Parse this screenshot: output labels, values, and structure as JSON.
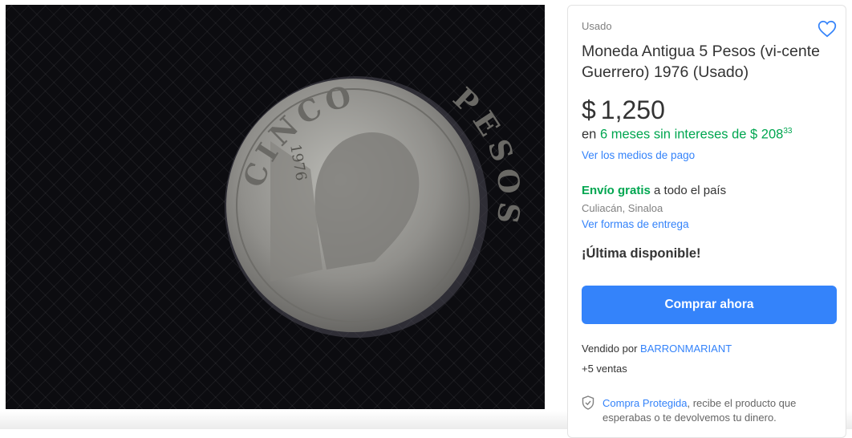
{
  "image": {
    "alt_icon": "coin-photo",
    "coin_text": {
      "top": "CINCO",
      "right": "PESOS",
      "year": "1976"
    }
  },
  "product": {
    "condition": "Usado",
    "title": "Moneda Antigua 5 Pesos (vi-cente Guerrero) 1976 (Usado)",
    "currency": "$",
    "price": "1,250",
    "installments": {
      "prefix": "en",
      "highlight": "6 meses sin intereses de $ 208",
      "cents": "33"
    },
    "payment_link": "Ver los medios de pago"
  },
  "shipping": {
    "free_label": "Envío gratis",
    "suffix": "a todo el país",
    "location": "Culiacán, Sinaloa",
    "delivery_link": "Ver formas de entrega"
  },
  "stock": "¡Última disponible!",
  "buy_button": "Comprar ahora",
  "seller": {
    "prefix": "Vendido por",
    "name": "BARRONMARIANT",
    "sales": "+5 ventas"
  },
  "protection": {
    "link": "Compra Protegida",
    "text": ", recibe el producto que esperabas o te devolvemos tu dinero."
  },
  "colors": {
    "accent": "#3483fa",
    "green": "#00a650"
  },
  "icons": {
    "favorite": "heart-outline-icon",
    "protection": "shield-check-icon"
  }
}
